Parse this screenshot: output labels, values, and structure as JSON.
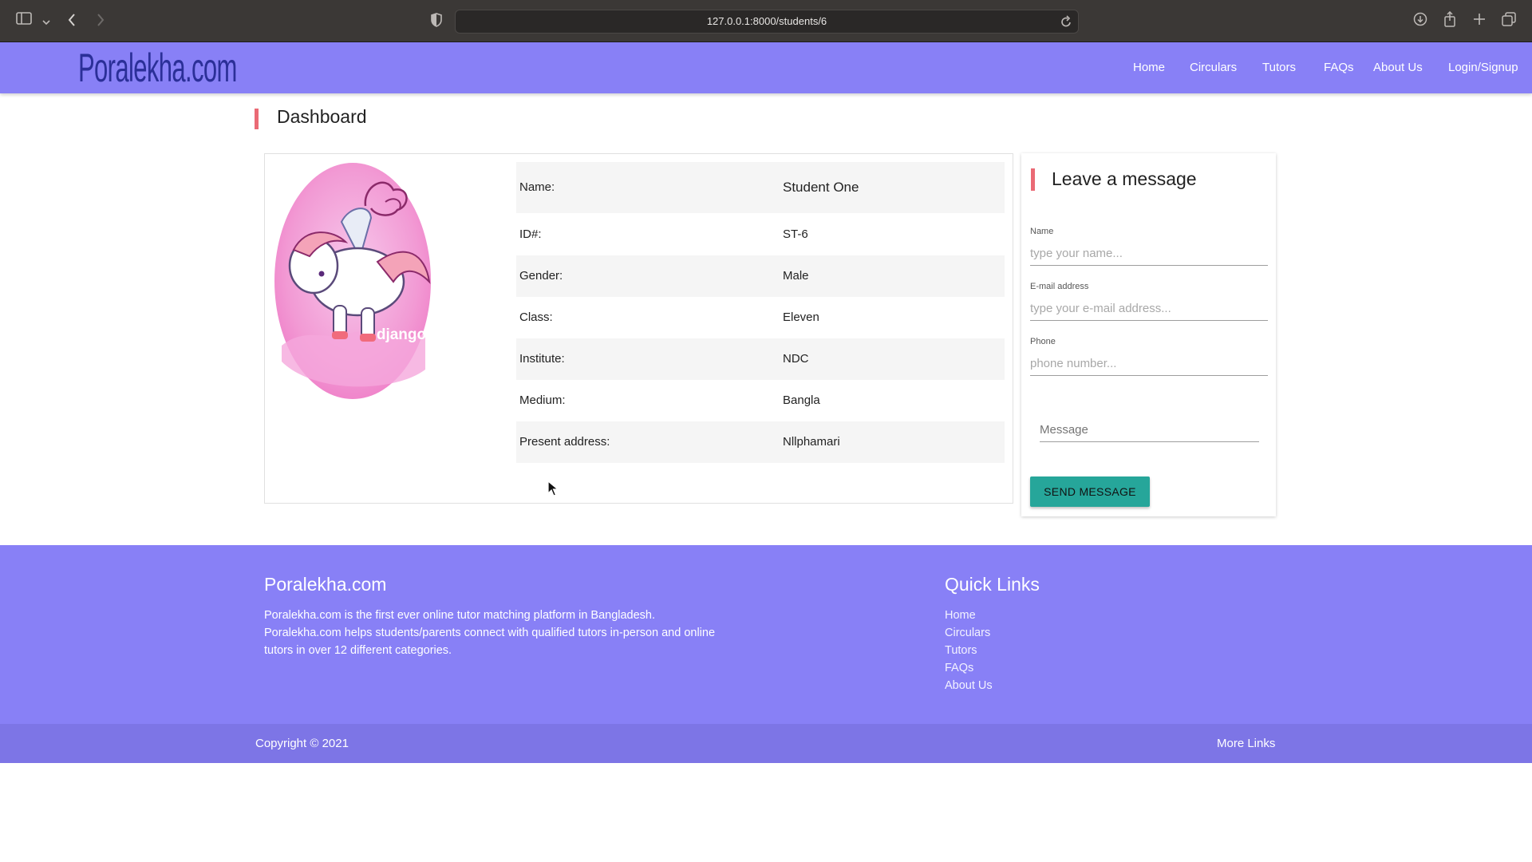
{
  "browser": {
    "url": "127.0.0.1:8000/students/6",
    "icons": [
      "sidebar-icon",
      "chevron-down-icon",
      "back-icon",
      "forward-icon",
      "shield-icon",
      "reload-icon",
      "download-icon",
      "share-icon",
      "new-tab-icon",
      "tabs-overview-icon"
    ]
  },
  "site": {
    "logo": "Poralekha.com",
    "nav": [
      "Home",
      "Circulars",
      "Tutors",
      "FAQs",
      "About Us",
      "Login/Signup"
    ]
  },
  "dashboard": {
    "title": "Dashboard",
    "avatar_icon": "django-pony-icon",
    "avatar_text": "django",
    "rows": [
      {
        "label": "Name:",
        "value": "Student One"
      },
      {
        "label": "ID#:",
        "value": "ST-6"
      },
      {
        "label": "Gender:",
        "value": "Male"
      },
      {
        "label": "Class:",
        "value": "Eleven"
      },
      {
        "label": "Institute:",
        "value": "NDC"
      },
      {
        "label": "Medium:",
        "value": "Bangla"
      },
      {
        "label": "Present address:",
        "value": "Nllphamari"
      }
    ]
  },
  "message_form": {
    "title": "Leave a message",
    "name_label": "Name",
    "name_placeholder": "type your name...",
    "email_label": "E-mail address",
    "email_placeholder": "type your e-mail address...",
    "phone_label": "Phone",
    "phone_placeholder": "phone number...",
    "message_placeholder": "Message",
    "send_label": "SEND MESSAGE"
  },
  "footer": {
    "brand": "Poralekha.com",
    "description": [
      "Poralekha.com is the first ever online tutor matching platform in Bangladesh.",
      "Poralekha.com helps students/parents connect with qualified tutors in-person and online",
      "tutors in over 12 different categories."
    ],
    "quick_links_title": "Quick Links",
    "quick_links": [
      "Home",
      "Circulars",
      "Tutors",
      "FAQs",
      "About Us"
    ],
    "copyright": "Copyright © 2021",
    "more_links": "More Links"
  },
  "colors": {
    "brand_purple": "#8880f6",
    "logo_blue": "#2b2f98",
    "accent_red": "#ea6a75",
    "button_teal": "#26a69a"
  }
}
